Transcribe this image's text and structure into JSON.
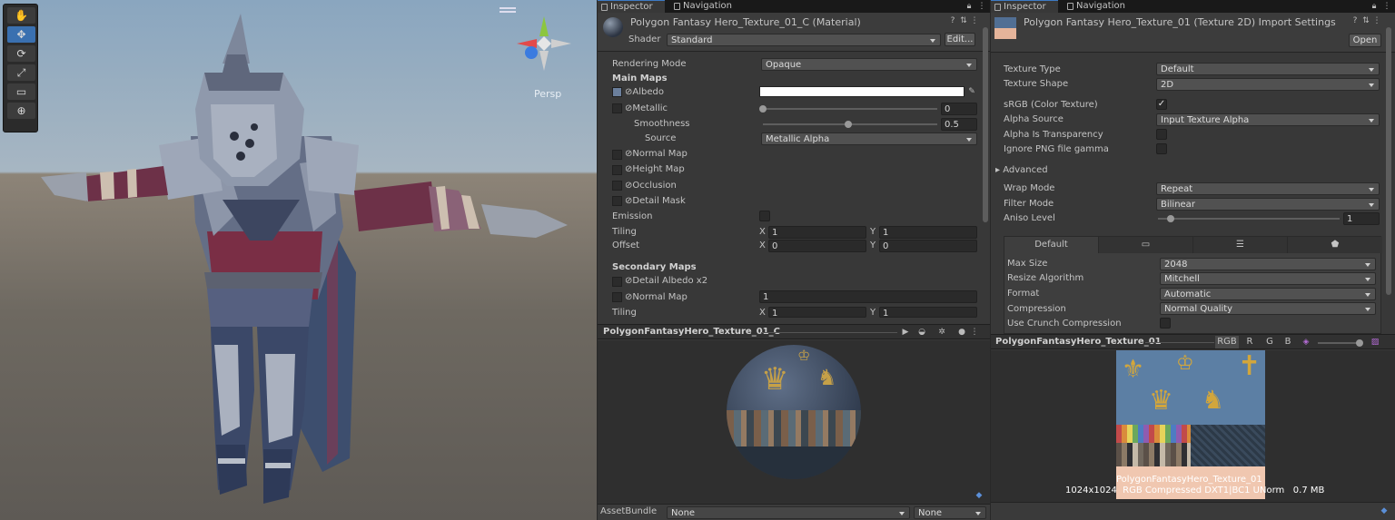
{
  "scene": {
    "persp_label": "Persp",
    "tools": [
      "hand-tool",
      "move-tool",
      "rotate-tool",
      "scale-tool",
      "rect-tool",
      "transform-tool"
    ]
  },
  "material_inspector": {
    "tabs": [
      "Inspector",
      "Navigation"
    ],
    "title": "Polygon Fantasy Hero_Texture_01_C (Material)",
    "shader_label": "Shader",
    "shader_value": "Standard",
    "edit_button": "Edit...",
    "rendering_mode_label": "Rendering Mode",
    "rendering_mode_value": "Opaque",
    "main_maps": "Main Maps",
    "albedo": "Albedo",
    "metallic": "Metallic",
    "metallic_value": "0",
    "smoothness": "Smoothness",
    "smoothness_value": "0.5",
    "source": "Source",
    "source_value": "Metallic Alpha",
    "normal_map": "Normal Map",
    "height_map": "Height Map",
    "occlusion": "Occlusion",
    "detail_mask": "Detail Mask",
    "emission": "Emission",
    "tiling": "Tiling",
    "offset": "Offset",
    "x_label": "X",
    "y_label": "Y",
    "tiling_x": "1",
    "tiling_y": "1",
    "offset_x": "0",
    "offset_y": "0",
    "secondary_maps": "Secondary Maps",
    "detail_albedo": "Detail Albedo x2",
    "normal_map_2": "Normal Map",
    "normal_map_2_value": "1",
    "tiling_2": "Tiling",
    "tiling_2_x": "1",
    "tiling_2_y": "1",
    "preview_title": "PolygonFantasyHero_Texture_01_C",
    "assetbundle_label": "AssetBundle",
    "assetbundle_value": "None",
    "assetbundle_variant": "None"
  },
  "texture_inspector": {
    "tabs": [
      "Inspector",
      "Navigation"
    ],
    "title": "Polygon Fantasy Hero_Texture_01 (Texture 2D) Import Settings",
    "open_button": "Open",
    "texture_type_label": "Texture Type",
    "texture_type_value": "Default",
    "texture_shape_label": "Texture Shape",
    "texture_shape_value": "2D",
    "srgb_label": "sRGB (Color Texture)",
    "alpha_source_label": "Alpha Source",
    "alpha_source_value": "Input Texture Alpha",
    "alpha_transparency_label": "Alpha Is Transparency",
    "ignore_png_label": "Ignore PNG file gamma",
    "advanced_label": "Advanced",
    "wrap_mode_label": "Wrap Mode",
    "wrap_mode_value": "Repeat",
    "filter_mode_label": "Filter Mode",
    "filter_mode_value": "Bilinear",
    "aniso_label": "Aniso Level",
    "aniso_value": "1",
    "platform_default_tab": "Default",
    "max_size_label": "Max Size",
    "max_size_value": "2048",
    "resize_label": "Resize Algorithm",
    "resize_value": "Mitchell",
    "format_label": "Format",
    "format_value": "Automatic",
    "compression_label": "Compression",
    "compression_value": "Normal Quality",
    "crunch_label": "Use Crunch Compression",
    "preview_title": "PolygonFantasyHero_Texture_01",
    "channel_rgb": "RGB",
    "channel_r": "R",
    "channel_g": "G",
    "channel_b": "B",
    "preview_caption_name": "PolygonFantasyHero_Texture_01",
    "preview_caption_info": "1024x1024  RGB Compressed DXT1|BC1 UNorm   0.7 MB"
  }
}
